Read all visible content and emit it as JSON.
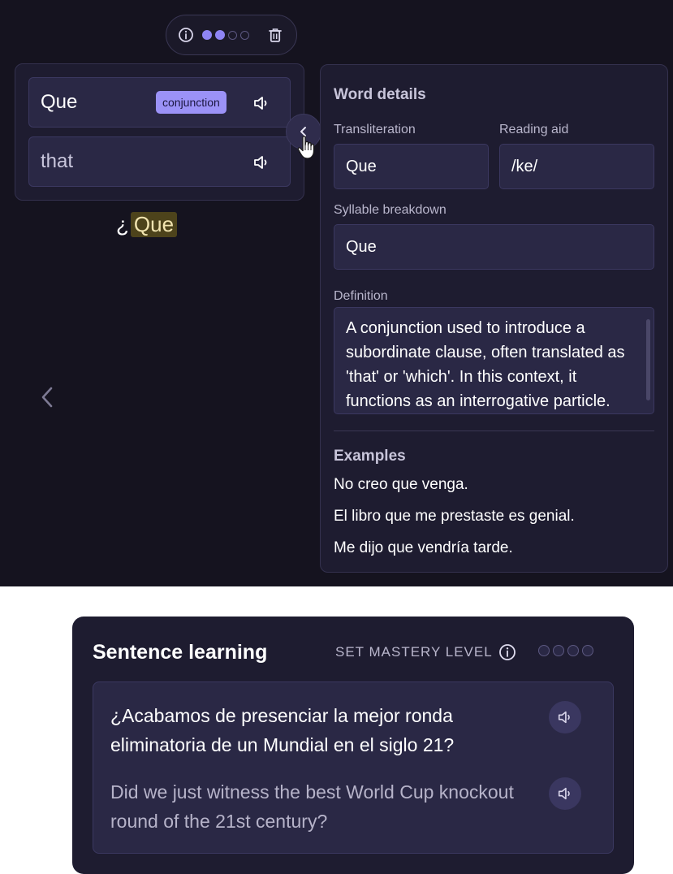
{
  "colors": {
    "app_background": "#15131f",
    "panel": "#1e1c30",
    "field": "#2a2845",
    "accent": "#8e84f5",
    "badge": "#9b92f7",
    "highlight": "#4d431b"
  },
  "mastery_toolbar": {
    "info_icon": "info-circle-icon",
    "mastery_level": 2,
    "mastery_max": 4,
    "delete_icon": "trash-icon"
  },
  "word_card": {
    "word": "Que",
    "part_of_speech": "conjunction",
    "meaning": "that",
    "speaker_icon": "speaker-icon"
  },
  "sentence_preview": {
    "leading": "¿",
    "highlighted_word": "Que"
  },
  "word_details": {
    "title": "Word details",
    "transliteration_label": "Transliteration",
    "transliteration_value": "Que",
    "reading_aid_label": "Reading aid",
    "reading_aid_value": "/ke/",
    "syllable_label": "Syllable breakdown",
    "syllable_value": "Que",
    "definition_label": "Definition",
    "definition_value": "A conjunction used to introduce a subordinate clause, often translated as 'that' or 'which'. In this context, it functions as an interrogative particle.",
    "examples_title": "Examples",
    "examples": [
      "No creo que venga.",
      "El libro que me prestaste es genial.",
      "Me dijo que vendría tarde."
    ]
  },
  "sentence_learning": {
    "title": "Sentence learning",
    "mastery_label": "SET MASTERY LEVEL",
    "mastery_level": 0,
    "mastery_max": 4,
    "sentence": "¿Acabamos de presenciar la mejor ronda eliminatoria de un Mundial en el siglo 21?",
    "translation": "Did we just witness the best World Cup knockout round of the 21st century?"
  }
}
